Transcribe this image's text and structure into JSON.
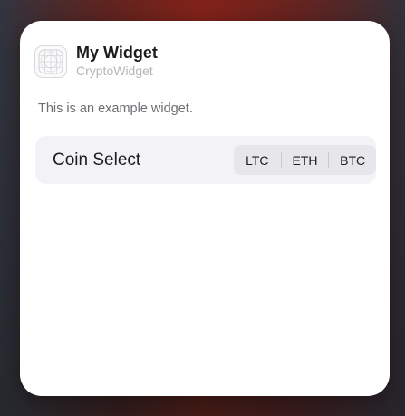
{
  "widget": {
    "title": "My Widget",
    "app_name": "CryptoWidget",
    "description": "This is an example widget."
  },
  "setting": {
    "label": "Coin Select",
    "options": [
      "LTC",
      "ETH",
      "BTC"
    ]
  },
  "icons": {
    "app": "grid-app-icon"
  }
}
